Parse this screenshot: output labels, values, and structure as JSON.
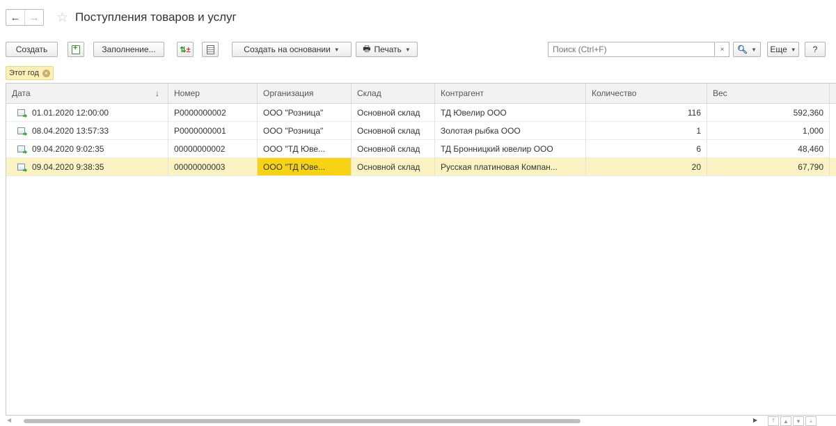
{
  "window": {
    "title": "Поступления товаров и услуг",
    "nav_back": "←",
    "nav_forward": "→",
    "favorite_icon": "star-outline-icon"
  },
  "toolbar": {
    "create": "Создать",
    "fill": "Заполнение...",
    "create_based_on": "Создать на основании",
    "print": "Печать",
    "search_placeholder": "Поиск (Ctrl+F)",
    "clear": "×",
    "search_icon": "Q",
    "more": "Еще",
    "help": "?"
  },
  "filter": {
    "label": "Этот год"
  },
  "table": {
    "columns": [
      "Дата",
      "Номер",
      "Организация",
      "Склад",
      "Контрагент",
      "Количество",
      "Вес"
    ],
    "sort_indicator": "↓",
    "rows": [
      {
        "date": "01.01.2020 12:00:00",
        "number": "Р0000000002",
        "org": "ООО \"Розница\"",
        "warehouse": "Основной склад",
        "counterparty": "ТД Ювелир ООО",
        "qty": "116",
        "weight": "592,360",
        "selected": false
      },
      {
        "date": "08.04.2020 13:57:33",
        "number": "Р0000000001",
        "org": "ООО \"Розница\"",
        "warehouse": "Основной склад",
        "counterparty": "Золотая рыбка ООО",
        "qty": "1",
        "weight": "1,000",
        "selected": false
      },
      {
        "date": "09.04.2020 9:02:35",
        "number": "00000000002",
        "org": "ООО \"ТД Юве...",
        "warehouse": "Основной склад",
        "counterparty": "ТД Бронницкий ювелир ООО",
        "qty": "6",
        "weight": "48,460",
        "selected": false
      },
      {
        "date": "09.04.2020 9:38:35",
        "number": "00000000003",
        "org": "ООО \"ТД Юве...",
        "warehouse": "Основной склад",
        "counterparty": "Русская платиновая Компан...",
        "qty": "20",
        "weight": "67,790",
        "selected": true
      }
    ]
  },
  "colors": {
    "selected_row": "#fbf3c3",
    "selected_cell": "#f7d316",
    "filter_bg": "#fbf1b6"
  }
}
